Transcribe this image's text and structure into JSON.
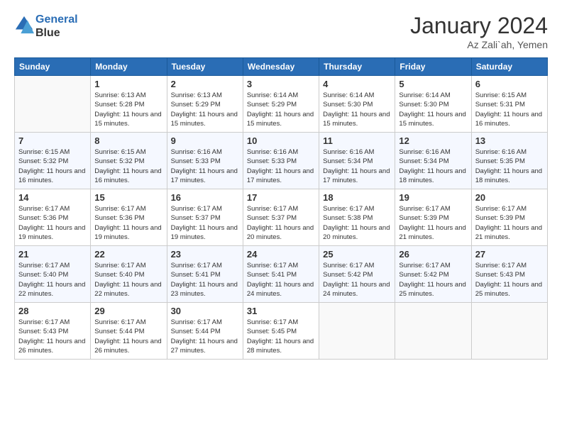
{
  "logo": {
    "line1": "General",
    "line2": "Blue"
  },
  "title": "January 2024",
  "subtitle": "Az Zali`ah, Yemen",
  "weekdays": [
    "Sunday",
    "Monday",
    "Tuesday",
    "Wednesday",
    "Thursday",
    "Friday",
    "Saturday"
  ],
  "weeks": [
    [
      {
        "day": "",
        "sunrise": "",
        "sunset": "",
        "daylight": ""
      },
      {
        "day": "1",
        "sunrise": "Sunrise: 6:13 AM",
        "sunset": "Sunset: 5:28 PM",
        "daylight": "Daylight: 11 hours and 15 minutes."
      },
      {
        "day": "2",
        "sunrise": "Sunrise: 6:13 AM",
        "sunset": "Sunset: 5:29 PM",
        "daylight": "Daylight: 11 hours and 15 minutes."
      },
      {
        "day": "3",
        "sunrise": "Sunrise: 6:14 AM",
        "sunset": "Sunset: 5:29 PM",
        "daylight": "Daylight: 11 hours and 15 minutes."
      },
      {
        "day": "4",
        "sunrise": "Sunrise: 6:14 AM",
        "sunset": "Sunset: 5:30 PM",
        "daylight": "Daylight: 11 hours and 15 minutes."
      },
      {
        "day": "5",
        "sunrise": "Sunrise: 6:14 AM",
        "sunset": "Sunset: 5:30 PM",
        "daylight": "Daylight: 11 hours and 15 minutes."
      },
      {
        "day": "6",
        "sunrise": "Sunrise: 6:15 AM",
        "sunset": "Sunset: 5:31 PM",
        "daylight": "Daylight: 11 hours and 16 minutes."
      }
    ],
    [
      {
        "day": "7",
        "sunrise": "Sunrise: 6:15 AM",
        "sunset": "Sunset: 5:32 PM",
        "daylight": "Daylight: 11 hours and 16 minutes."
      },
      {
        "day": "8",
        "sunrise": "Sunrise: 6:15 AM",
        "sunset": "Sunset: 5:32 PM",
        "daylight": "Daylight: 11 hours and 16 minutes."
      },
      {
        "day": "9",
        "sunrise": "Sunrise: 6:16 AM",
        "sunset": "Sunset: 5:33 PM",
        "daylight": "Daylight: 11 hours and 17 minutes."
      },
      {
        "day": "10",
        "sunrise": "Sunrise: 6:16 AM",
        "sunset": "Sunset: 5:33 PM",
        "daylight": "Daylight: 11 hours and 17 minutes."
      },
      {
        "day": "11",
        "sunrise": "Sunrise: 6:16 AM",
        "sunset": "Sunset: 5:34 PM",
        "daylight": "Daylight: 11 hours and 17 minutes."
      },
      {
        "day": "12",
        "sunrise": "Sunrise: 6:16 AM",
        "sunset": "Sunset: 5:34 PM",
        "daylight": "Daylight: 11 hours and 18 minutes."
      },
      {
        "day": "13",
        "sunrise": "Sunrise: 6:16 AM",
        "sunset": "Sunset: 5:35 PM",
        "daylight": "Daylight: 11 hours and 18 minutes."
      }
    ],
    [
      {
        "day": "14",
        "sunrise": "Sunrise: 6:17 AM",
        "sunset": "Sunset: 5:36 PM",
        "daylight": "Daylight: 11 hours and 19 minutes."
      },
      {
        "day": "15",
        "sunrise": "Sunrise: 6:17 AM",
        "sunset": "Sunset: 5:36 PM",
        "daylight": "Daylight: 11 hours and 19 minutes."
      },
      {
        "day": "16",
        "sunrise": "Sunrise: 6:17 AM",
        "sunset": "Sunset: 5:37 PM",
        "daylight": "Daylight: 11 hours and 19 minutes."
      },
      {
        "day": "17",
        "sunrise": "Sunrise: 6:17 AM",
        "sunset": "Sunset: 5:37 PM",
        "daylight": "Daylight: 11 hours and 20 minutes."
      },
      {
        "day": "18",
        "sunrise": "Sunrise: 6:17 AM",
        "sunset": "Sunset: 5:38 PM",
        "daylight": "Daylight: 11 hours and 20 minutes."
      },
      {
        "day": "19",
        "sunrise": "Sunrise: 6:17 AM",
        "sunset": "Sunset: 5:39 PM",
        "daylight": "Daylight: 11 hours and 21 minutes."
      },
      {
        "day": "20",
        "sunrise": "Sunrise: 6:17 AM",
        "sunset": "Sunset: 5:39 PM",
        "daylight": "Daylight: 11 hours and 21 minutes."
      }
    ],
    [
      {
        "day": "21",
        "sunrise": "Sunrise: 6:17 AM",
        "sunset": "Sunset: 5:40 PM",
        "daylight": "Daylight: 11 hours and 22 minutes."
      },
      {
        "day": "22",
        "sunrise": "Sunrise: 6:17 AM",
        "sunset": "Sunset: 5:40 PM",
        "daylight": "Daylight: 11 hours and 22 minutes."
      },
      {
        "day": "23",
        "sunrise": "Sunrise: 6:17 AM",
        "sunset": "Sunset: 5:41 PM",
        "daylight": "Daylight: 11 hours and 23 minutes."
      },
      {
        "day": "24",
        "sunrise": "Sunrise: 6:17 AM",
        "sunset": "Sunset: 5:41 PM",
        "daylight": "Daylight: 11 hours and 24 minutes."
      },
      {
        "day": "25",
        "sunrise": "Sunrise: 6:17 AM",
        "sunset": "Sunset: 5:42 PM",
        "daylight": "Daylight: 11 hours and 24 minutes."
      },
      {
        "day": "26",
        "sunrise": "Sunrise: 6:17 AM",
        "sunset": "Sunset: 5:42 PM",
        "daylight": "Daylight: 11 hours and 25 minutes."
      },
      {
        "day": "27",
        "sunrise": "Sunrise: 6:17 AM",
        "sunset": "Sunset: 5:43 PM",
        "daylight": "Daylight: 11 hours and 25 minutes."
      }
    ],
    [
      {
        "day": "28",
        "sunrise": "Sunrise: 6:17 AM",
        "sunset": "Sunset: 5:43 PM",
        "daylight": "Daylight: 11 hours and 26 minutes."
      },
      {
        "day": "29",
        "sunrise": "Sunrise: 6:17 AM",
        "sunset": "Sunset: 5:44 PM",
        "daylight": "Daylight: 11 hours and 26 minutes."
      },
      {
        "day": "30",
        "sunrise": "Sunrise: 6:17 AM",
        "sunset": "Sunset: 5:44 PM",
        "daylight": "Daylight: 11 hours and 27 minutes."
      },
      {
        "day": "31",
        "sunrise": "Sunrise: 6:17 AM",
        "sunset": "Sunset: 5:45 PM",
        "daylight": "Daylight: 11 hours and 28 minutes."
      },
      {
        "day": "",
        "sunrise": "",
        "sunset": "",
        "daylight": ""
      },
      {
        "day": "",
        "sunrise": "",
        "sunset": "",
        "daylight": ""
      },
      {
        "day": "",
        "sunrise": "",
        "sunset": "",
        "daylight": ""
      }
    ]
  ]
}
